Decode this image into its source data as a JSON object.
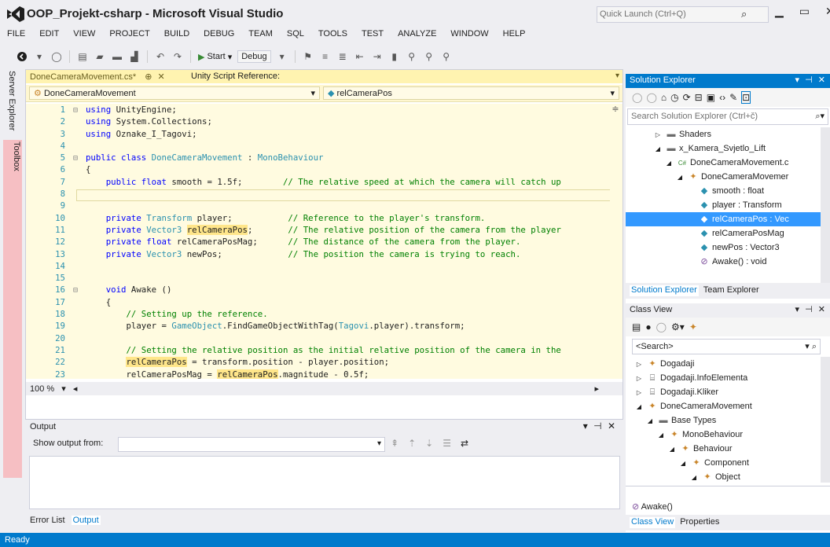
{
  "window": {
    "title": "OOP_Projekt-csharp - Microsoft Visual Studio",
    "quick_launch_placeholder": "Quick Launch (Ctrl+Q)",
    "minimize": "▁",
    "maximize": "▭",
    "close": "✕"
  },
  "menu": [
    "FILE",
    "EDIT",
    "VIEW",
    "PROJECT",
    "BUILD",
    "DEBUG",
    "TEAM",
    "SQL",
    "TOOLS",
    "TEST",
    "ANALYZE",
    "WINDOW",
    "HELP"
  ],
  "toolbar": {
    "start_label": "Start",
    "config": "Debug"
  },
  "left_tabs": {
    "server_explorer": "Server Explorer",
    "toolbox": "Toolbox"
  },
  "editor": {
    "tabs": [
      {
        "label": "DoneCameraMovement.cs*",
        "pin": "⊕",
        "close": "✕",
        "active": true
      },
      {
        "label": "Unity Script Reference:",
        "active": false
      }
    ],
    "nav_left": "DoneCameraMovement",
    "nav_right": "relCameraPos",
    "zoom": "100 %",
    "lines": [
      {
        "n": "1",
        "fold": "⊟",
        "segs": [
          [
            "kw",
            "using"
          ],
          [
            "tx",
            " UnityEngine;"
          ]
        ]
      },
      {
        "n": "2",
        "fold": "",
        "segs": [
          [
            "kw",
            "using"
          ],
          [
            "tx",
            " System.Collections;"
          ]
        ]
      },
      {
        "n": "3",
        "fold": "",
        "segs": [
          [
            "kw",
            "using"
          ],
          [
            "tx",
            " Oznake_I_Tagovi;"
          ]
        ]
      },
      {
        "n": "4",
        "fold": "",
        "segs": []
      },
      {
        "n": "5",
        "fold": "⊟",
        "segs": [
          [
            "kw",
            "public class"
          ],
          [
            "tx",
            " "
          ],
          [
            "ty",
            "DoneCameraMovement"
          ],
          [
            "tx",
            " : "
          ],
          [
            "ty",
            "MonoBehaviour"
          ]
        ]
      },
      {
        "n": "6",
        "fold": "",
        "segs": [
          [
            "tx",
            "{"
          ]
        ]
      },
      {
        "n": "7",
        "fold": "",
        "segs": [
          [
            "tx",
            "    "
          ],
          [
            "kw",
            "public float"
          ],
          [
            "tx",
            " smooth = 1.5f;        "
          ],
          [
            "cm",
            "// The relative speed at which the camera will catch up"
          ]
        ]
      },
      {
        "n": "8",
        "fold": "",
        "segs": []
      },
      {
        "n": "9",
        "fold": "",
        "segs": []
      },
      {
        "n": "10",
        "fold": "",
        "segs": [
          [
            "tx",
            "    "
          ],
          [
            "kw",
            "private"
          ],
          [
            "tx",
            " "
          ],
          [
            "ty",
            "Transform"
          ],
          [
            "tx",
            " player;           "
          ],
          [
            "cm",
            "// Reference to the player's transform."
          ]
        ]
      },
      {
        "n": "11",
        "fold": "",
        "segs": [
          [
            "tx",
            "    "
          ],
          [
            "kw",
            "private"
          ],
          [
            "tx",
            " "
          ],
          [
            "ty",
            "Vector3"
          ],
          [
            "tx",
            " "
          ],
          [
            "hl",
            "relCameraPos"
          ],
          [
            "tx",
            ";       "
          ],
          [
            "cm",
            "// The relative position of the camera from the player"
          ]
        ]
      },
      {
        "n": "12",
        "fold": "",
        "segs": [
          [
            "tx",
            "    "
          ],
          [
            "kw",
            "private float"
          ],
          [
            "tx",
            " relCameraPosMag;      "
          ],
          [
            "cm",
            "// The distance of the camera from the player."
          ]
        ]
      },
      {
        "n": "13",
        "fold": "",
        "segs": [
          [
            "tx",
            "    "
          ],
          [
            "kw",
            "private"
          ],
          [
            "tx",
            " "
          ],
          [
            "ty",
            "Vector3"
          ],
          [
            "tx",
            " newPos;             "
          ],
          [
            "cm",
            "// The position the camera is trying to reach."
          ]
        ]
      },
      {
        "n": "14",
        "fold": "",
        "segs": []
      },
      {
        "n": "15",
        "fold": "",
        "segs": []
      },
      {
        "n": "16",
        "fold": "⊟",
        "segs": [
          [
            "tx",
            "    "
          ],
          [
            "kw",
            "void"
          ],
          [
            "tx",
            " Awake ()"
          ]
        ]
      },
      {
        "n": "17",
        "fold": "",
        "segs": [
          [
            "tx",
            "    {"
          ]
        ]
      },
      {
        "n": "18",
        "fold": "",
        "segs": [
          [
            "tx",
            "        "
          ],
          [
            "cm",
            "// Setting up the reference."
          ]
        ]
      },
      {
        "n": "19",
        "fold": "",
        "segs": [
          [
            "tx",
            "        player = "
          ],
          [
            "ty",
            "GameObject"
          ],
          [
            "tx",
            ".FindGameObjectWithTag("
          ],
          [
            "ty",
            "Tagovi"
          ],
          [
            "tx",
            ".player).transform;"
          ]
        ]
      },
      {
        "n": "20",
        "fold": "",
        "segs": []
      },
      {
        "n": "21",
        "fold": "",
        "segs": [
          [
            "tx",
            "        "
          ],
          [
            "cm",
            "// Setting the relative position as the initial relative position of the camera in the"
          ]
        ]
      },
      {
        "n": "22",
        "fold": "",
        "segs": [
          [
            "tx",
            "        "
          ],
          [
            "hl",
            "relCameraPos"
          ],
          [
            "tx",
            " = transform.position - player.position;"
          ]
        ]
      },
      {
        "n": "23",
        "fold": "",
        "segs": [
          [
            "tx",
            "        relCameraPosMag = "
          ],
          [
            "hl",
            "relCameraPos"
          ],
          [
            "tx",
            ".magnitude - 0.5f;"
          ]
        ]
      }
    ]
  },
  "output": {
    "header": "Output",
    "show_from": "Show output from:",
    "tabs": [
      {
        "label": "Error List",
        "active": false
      },
      {
        "label": "Output",
        "active": true
      }
    ]
  },
  "solution_explorer": {
    "header": "Solution Explorer",
    "search_placeholder": "Search Solution Explorer (Ctrl+č)",
    "items": [
      {
        "indent": 34,
        "exp": "▷",
        "icon": "folder",
        "label": "Shaders",
        "sel": false
      },
      {
        "indent": 34,
        "exp": "◢",
        "icon": "folder",
        "label": "x_Kamera_Svjetlo_Lift",
        "sel": false
      },
      {
        "indent": 48,
        "exp": "◢",
        "icon": "cs",
        "label": "DoneCameraMovement.c",
        "sel": false
      },
      {
        "indent": 62,
        "exp": "◢",
        "icon": "class",
        "label": "DoneCameraMovemer",
        "sel": false
      },
      {
        "indent": 76,
        "exp": "",
        "icon": "field",
        "label": "smooth : float",
        "sel": false
      },
      {
        "indent": 76,
        "exp": "",
        "icon": "field",
        "label": "player : Transform",
        "sel": false
      },
      {
        "indent": 76,
        "exp": "",
        "icon": "field",
        "label": "relCameraPos : Vec",
        "sel": true
      },
      {
        "indent": 76,
        "exp": "",
        "icon": "field",
        "label": "relCameraPosMag",
        "sel": false
      },
      {
        "indent": 76,
        "exp": "",
        "icon": "field",
        "label": "newPos : Vector3",
        "sel": false
      },
      {
        "indent": 76,
        "exp": "",
        "icon": "method",
        "label": "Awake() : void",
        "sel": false
      }
    ],
    "tabs": [
      {
        "label": "Solution Explorer",
        "active": true
      },
      {
        "label": "Team Explorer",
        "active": false
      }
    ]
  },
  "class_view": {
    "header": "Class View",
    "search_value": "<Search>",
    "items": [
      {
        "indent": 10,
        "exp": "▷",
        "icon": "class",
        "label": "Dogadaji"
      },
      {
        "indent": 10,
        "exp": "▷",
        "icon": "ns",
        "label": "Dogadaji.InfoElementa"
      },
      {
        "indent": 10,
        "exp": "▷",
        "icon": "ns",
        "label": "Dogadaji.Kliker"
      },
      {
        "indent": 10,
        "exp": "◢",
        "icon": "class",
        "label": "DoneCameraMovement"
      },
      {
        "indent": 24,
        "exp": "◢",
        "icon": "folder",
        "label": "Base Types"
      },
      {
        "indent": 38,
        "exp": "◢",
        "icon": "class",
        "label": "MonoBehaviour"
      },
      {
        "indent": 52,
        "exp": "◢",
        "icon": "class",
        "label": "Behaviour"
      },
      {
        "indent": 66,
        "exp": "◢",
        "icon": "class",
        "label": "Component"
      },
      {
        "indent": 80,
        "exp": "◢",
        "icon": "class",
        "label": "Object"
      },
      {
        "indent": 94,
        "exp": "",
        "icon": "class",
        "label": "Object"
      }
    ],
    "member": "Awake()",
    "tabs": [
      {
        "label": "Class View",
        "active": true
      },
      {
        "label": "Properties",
        "active": false
      }
    ]
  },
  "status": "Ready",
  "colors": {
    "accent": "#007acc",
    "highlight": "#ffe68a",
    "keyword": "#0000ff",
    "type": "#2b91af",
    "comment": "#008000"
  }
}
